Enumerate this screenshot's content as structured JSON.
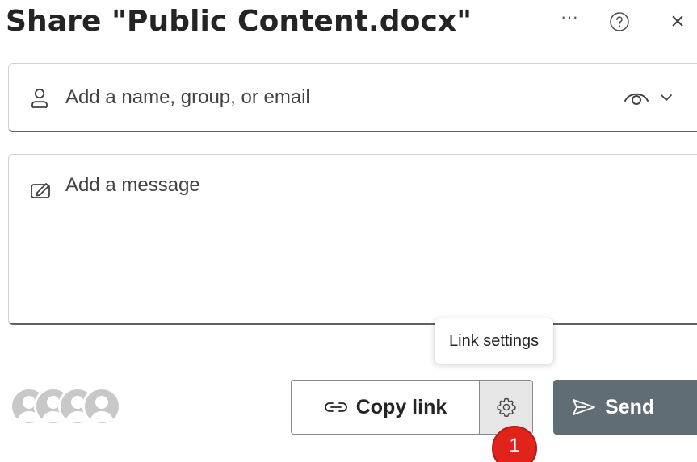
{
  "header": {
    "title": "Share \"Public Content.docx\"",
    "more_label": "···",
    "close_label": "×"
  },
  "recipient": {
    "placeholder": "Add a name, group, or email",
    "icon": "person-icon",
    "permission_icon": "eye-icon"
  },
  "message": {
    "placeholder": "Add a message",
    "icon": "edit-message-icon"
  },
  "tooltip": {
    "text": "Link settings"
  },
  "actions": {
    "copy_link_label": "Copy link",
    "send_label": "Send",
    "badge_count": "1"
  },
  "colors": {
    "send_bg": "#616d74",
    "badge": "#e1231b",
    "avatar": "#c8c8c8"
  }
}
